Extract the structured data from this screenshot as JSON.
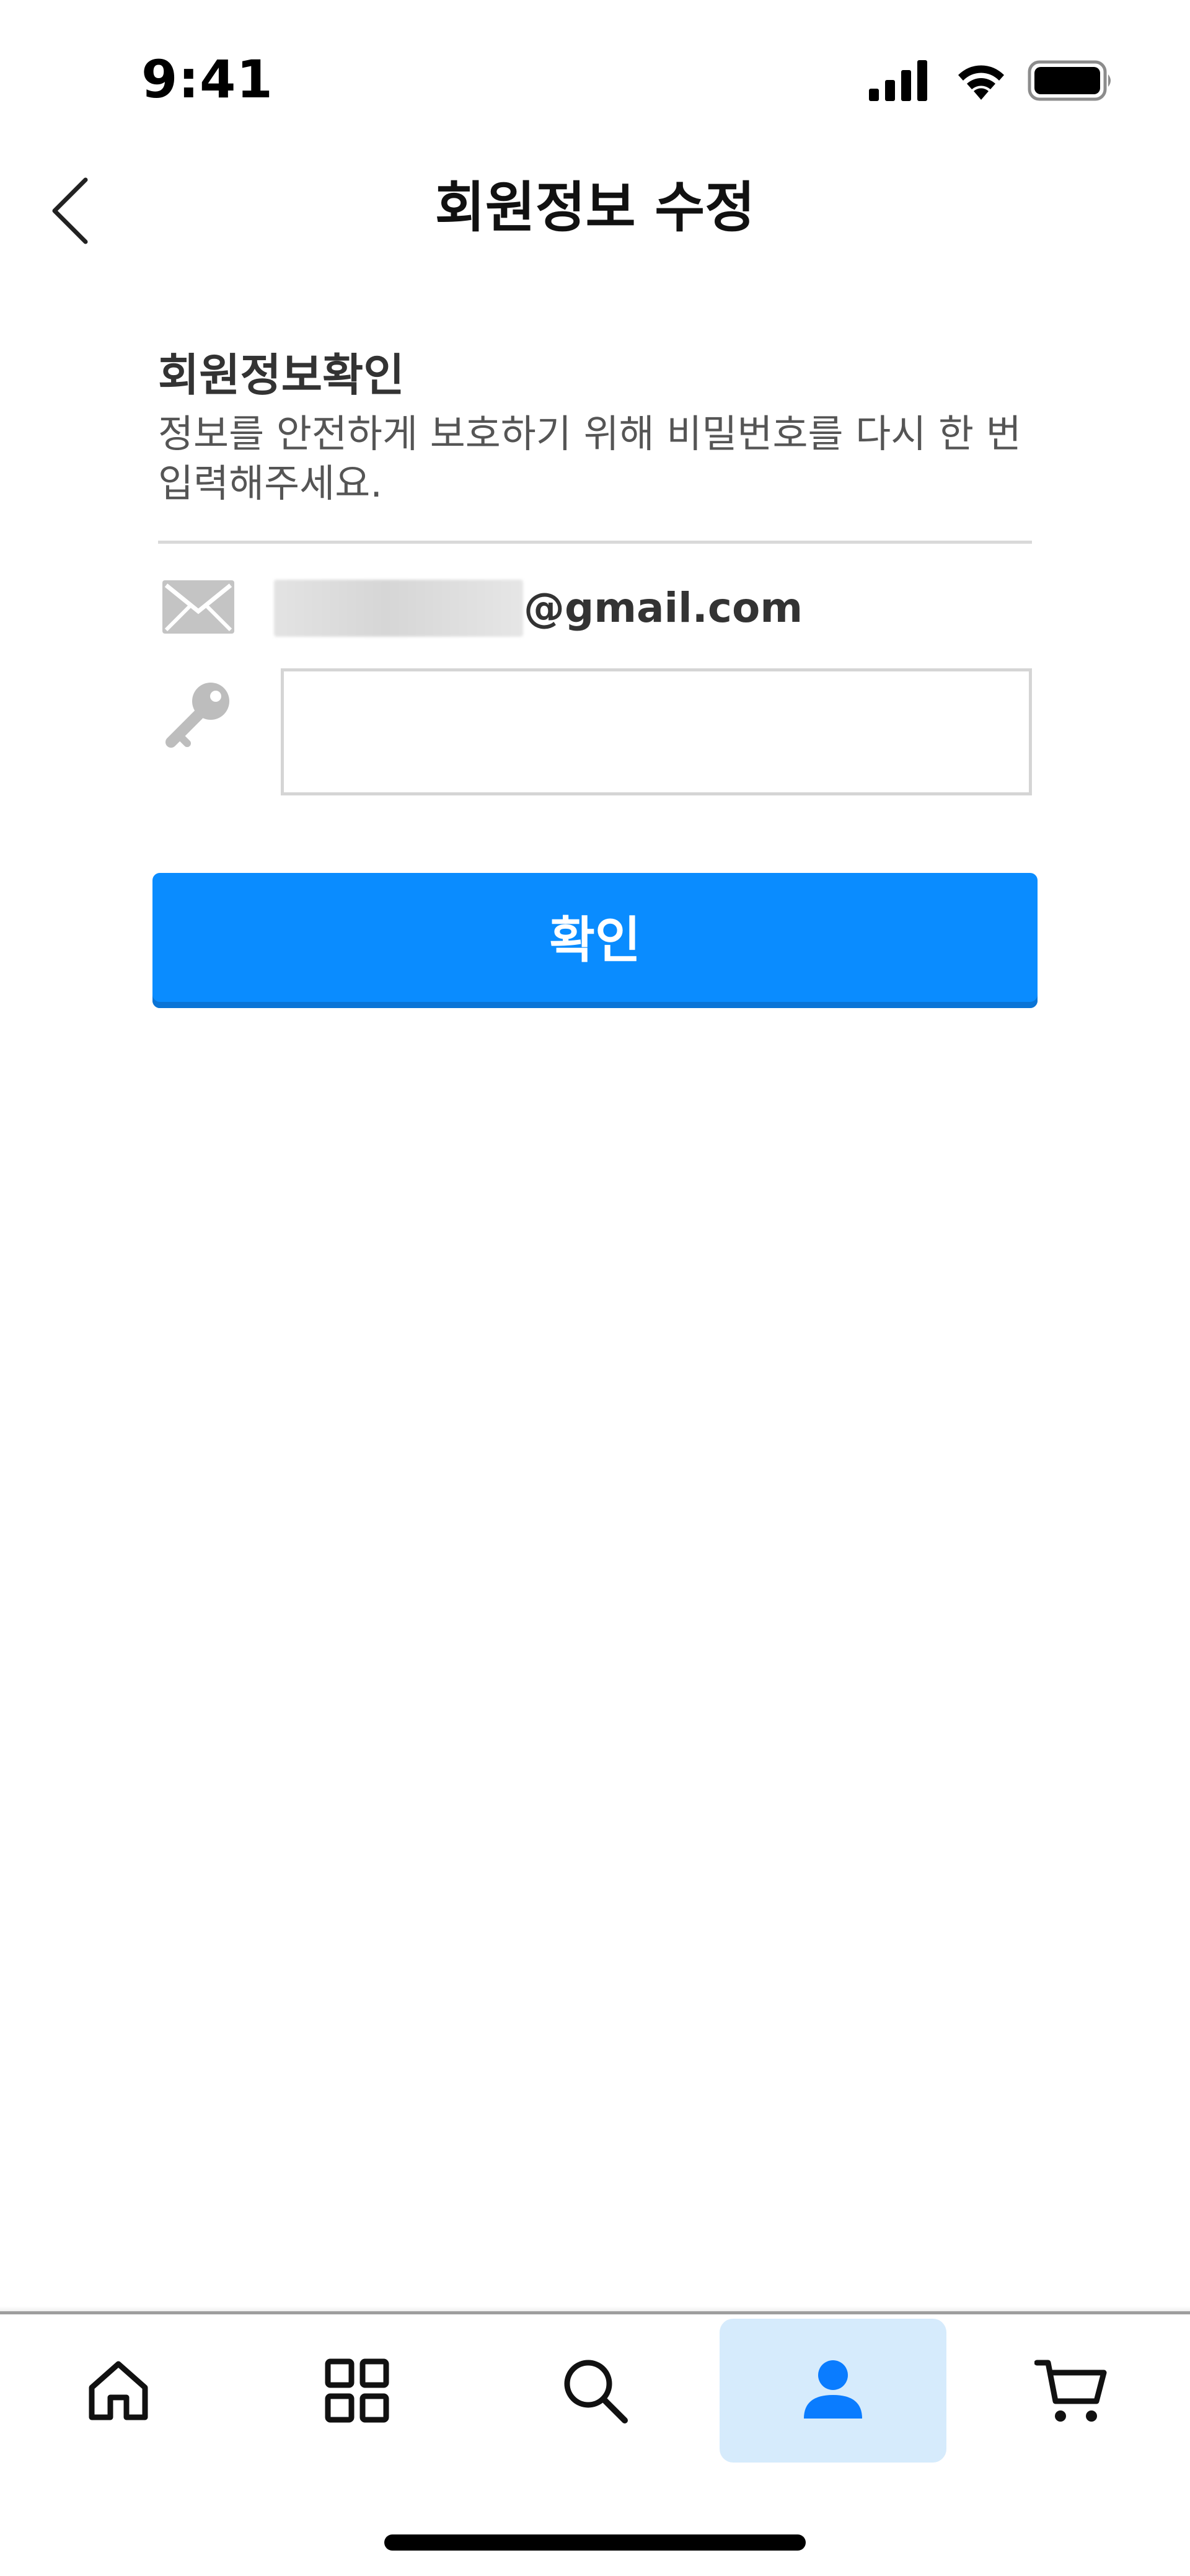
{
  "status_bar": {
    "time": "9:41"
  },
  "header": {
    "title": "회원정보 수정"
  },
  "section": {
    "title": "회원정보확인",
    "description": "정보를 안전하게 보호하기 위해 비밀번호를 다시 한 번 입력해주세요."
  },
  "account": {
    "email_domain": "@gmail.com"
  },
  "password": {
    "value": "",
    "placeholder": ""
  },
  "confirm_button": {
    "label": "확인"
  },
  "tabbar": {
    "active_tab": "profile",
    "tabs": [
      {
        "id": "home",
        "icon": "home-icon"
      },
      {
        "id": "categories",
        "icon": "grid-icon"
      },
      {
        "id": "search",
        "icon": "search-icon"
      },
      {
        "id": "profile",
        "icon": "person-icon"
      },
      {
        "id": "cart",
        "icon": "cart-icon"
      }
    ]
  },
  "colors": {
    "accent": "#0a8cff",
    "active_tab_bg": "#d6ebfc",
    "icon_gray": "#c4c4c4"
  }
}
